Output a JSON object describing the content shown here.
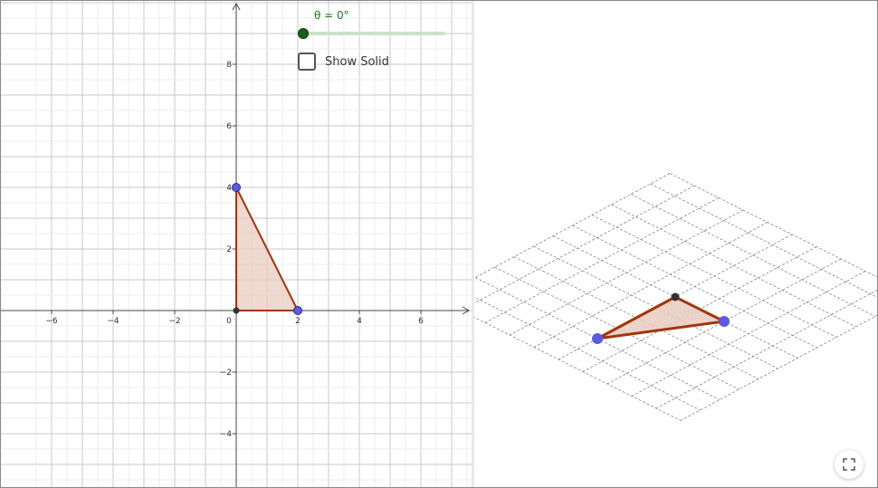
{
  "slider": {
    "label": "θ = 0°",
    "value": 0,
    "min": 0,
    "max": 360,
    "color": "#1b7a1b"
  },
  "checkbox": {
    "label": "Show Solid",
    "checked": false
  },
  "axes": {
    "x_ticks": [
      "−6",
      "−4",
      "−2",
      "0",
      "2",
      "4",
      "6"
    ],
    "y_ticks": [
      "8",
      "6",
      "4",
      "2",
      "−2",
      "−4"
    ]
  },
  "triangle": {
    "vertices": [
      [
        0,
        0
      ],
      [
        2,
        0
      ],
      [
        0,
        4
      ]
    ],
    "fill": "#e9cbbf",
    "stroke": "#a0360b",
    "point_color": "#5a5ae6",
    "origin_color": "#333333"
  },
  "view3d": {
    "plane_grid": true
  },
  "icons": {
    "fullscreen": "fullscreen-icon"
  }
}
